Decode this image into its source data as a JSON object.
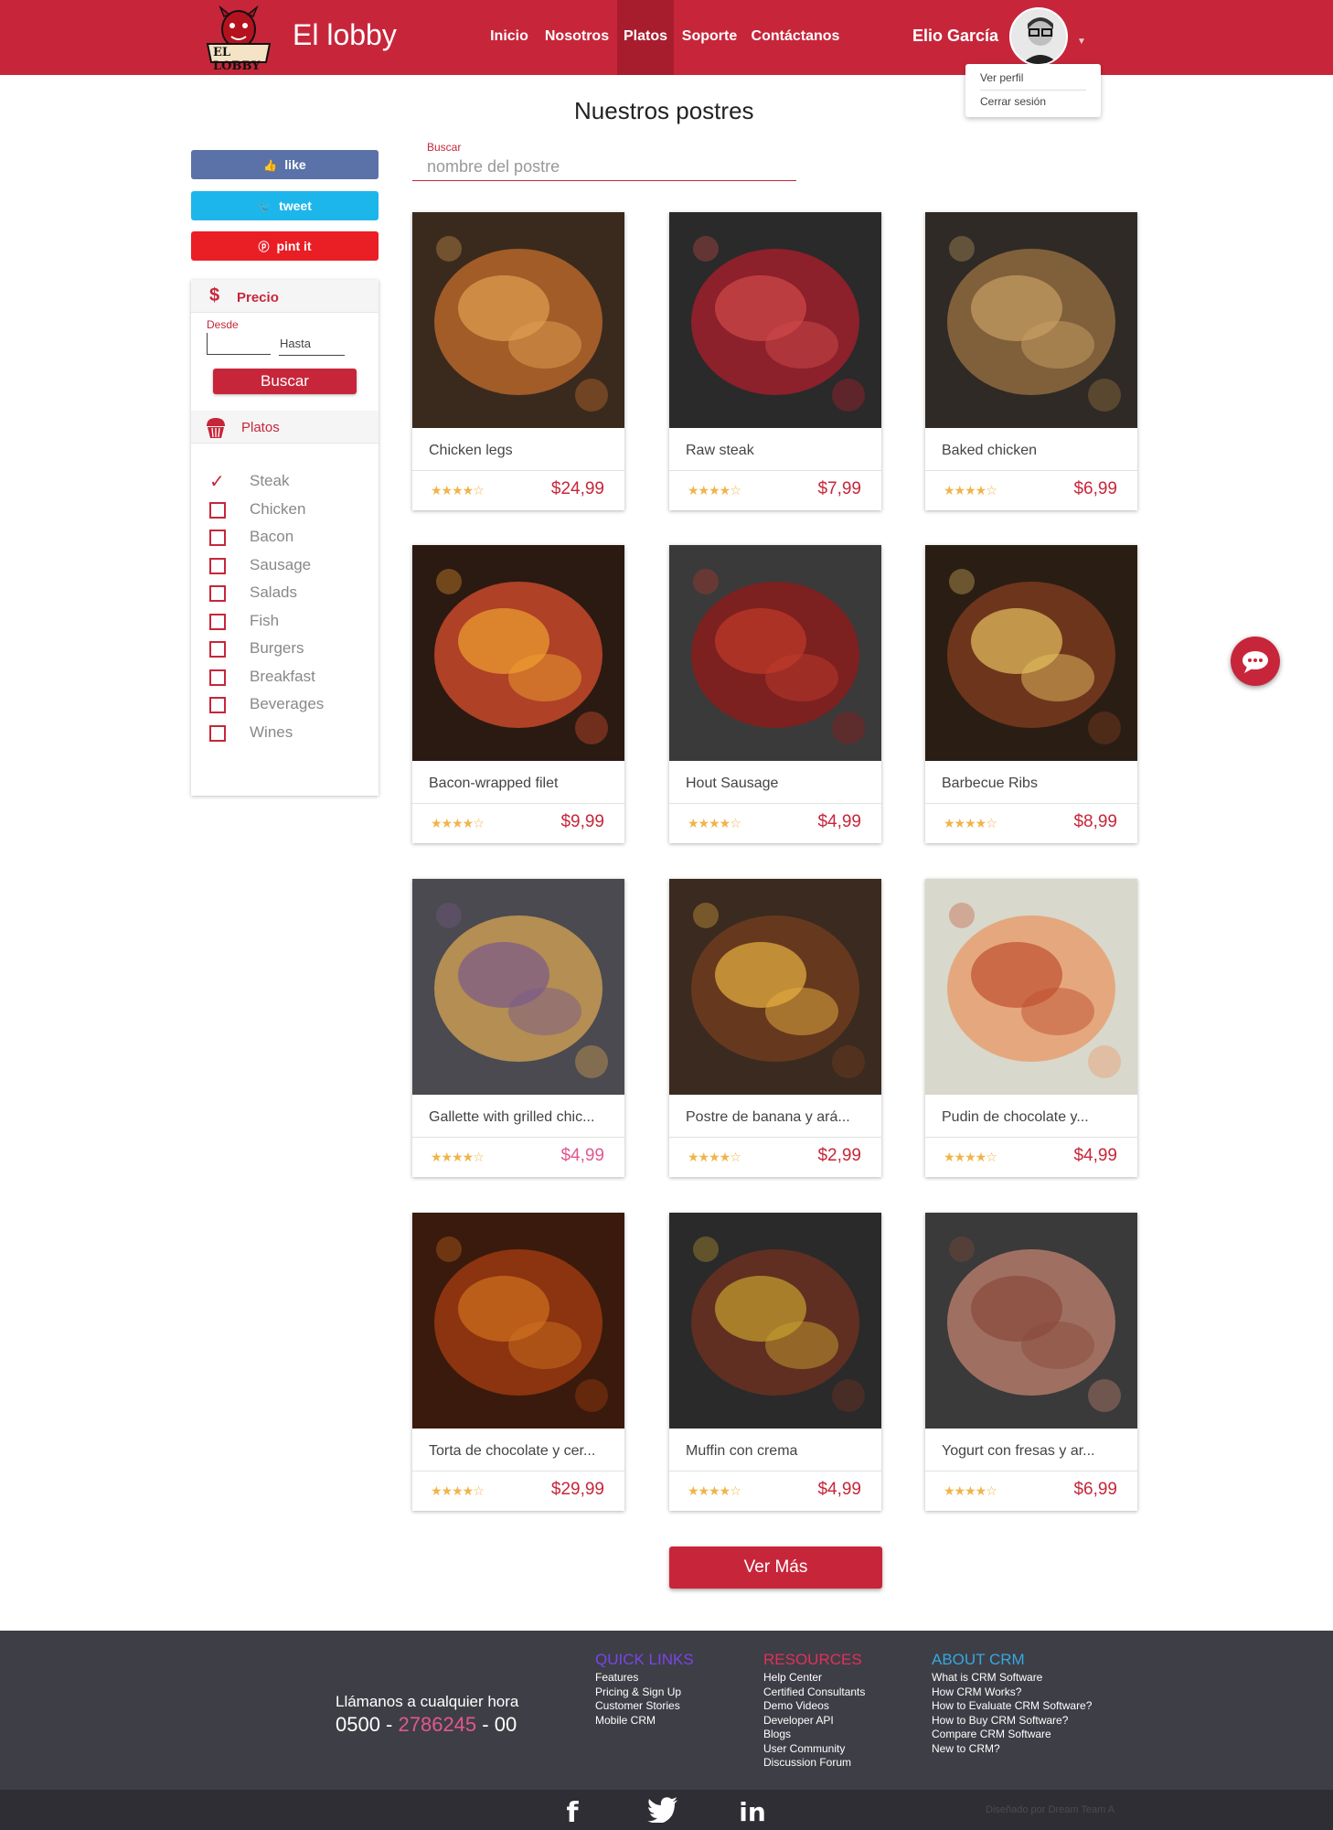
{
  "header": {
    "logo_text": "EL LOBBY",
    "brand": "El lobby",
    "nav": [
      "Inicio",
      "Nosotros",
      "Platos",
      "Soporte",
      "Contáctanos"
    ],
    "user_name": "Elio García"
  },
  "user_menu": {
    "view_profile": "Ver perfil",
    "logout": "Cerrar sesión"
  },
  "page_title": "Nuestros postres",
  "social": {
    "like": "like",
    "tweet": "tweet",
    "pin": "pint it"
  },
  "filter": {
    "price_title": "Precio",
    "price_symbol": "$",
    "from_label": "Desde",
    "to_label": "Hasta",
    "search_button": "Buscar",
    "categories_title": "Platos",
    "categories": [
      {
        "label": "Steak",
        "checked": true
      },
      {
        "label": "Chicken",
        "checked": false
      },
      {
        "label": "Bacon",
        "checked": false
      },
      {
        "label": "Sausage",
        "checked": false
      },
      {
        "label": "Salads",
        "checked": false
      },
      {
        "label": "Fish",
        "checked": false
      },
      {
        "label": "Burgers",
        "checked": false
      },
      {
        "label": "Breakfast",
        "checked": false
      },
      {
        "label": "Beverages",
        "checked": false
      },
      {
        "label": "Wines",
        "checked": false
      }
    ]
  },
  "search": {
    "label": "Buscar",
    "placeholder": "nombre del postre"
  },
  "products": [
    {
      "name": "Chicken legs",
      "price": "$24,99",
      "rating": 4.5
    },
    {
      "name": "Raw steak",
      "price": "$7,99",
      "rating": 4.5
    },
    {
      "name": "Baked chicken",
      "price": "$6,99",
      "rating": 4.5
    },
    {
      "name": "Bacon-wrapped filet",
      "price": "$9,99",
      "rating": 4.5
    },
    {
      "name": "Hout Sausage",
      "price": "$4,99",
      "rating": 4.5
    },
    {
      "name": "Barbecue Ribs",
      "price": "$8,99",
      "rating": 4.5
    },
    {
      "name": "Gallette with grilled chic...",
      "price": "$4,99",
      "rating": 4.5
    },
    {
      "name": "Postre de banana y ará...",
      "price": "$2,99",
      "rating": 4.5
    },
    {
      "name": "Pudin de chocolate y...",
      "price": "$4,99",
      "rating": 4.5
    },
    {
      "name": "Torta de chocolate y cer...",
      "price": "$29,99",
      "rating": 4.5
    },
    {
      "name": "Muffin con crema",
      "price": "$4,99",
      "rating": 4.5
    },
    {
      "name": "Yogurt con fresas y ar...",
      "price": "$6,99",
      "rating": 4.5
    }
  ],
  "load_more": "Ver Más",
  "footer": {
    "call_label": "Llámanos a cualquier hora",
    "phone_start": "0500 - ",
    "phone_mid": "2786245",
    "phone_end": " - 00",
    "quick_links": {
      "title": "QUICK LINKS",
      "links": [
        "Features",
        "Pricing & Sign Up",
        "Customer Stories",
        "Mobile CRM"
      ]
    },
    "resources": {
      "title": "RESOURCES",
      "links": [
        "Help Center",
        "Certified Consultants",
        "Demo Videos",
        "Developer API",
        "Blogs",
        "User Community",
        "Discussion Forum"
      ]
    },
    "about": {
      "title": "ABOUT CRM",
      "links": [
        "What is CRM Software",
        "How CRM Works?",
        "How to Evaluate CRM Software?",
        "How to Buy CRM Software?",
        "Compare CRM Software",
        "New to CRM?"
      ]
    },
    "social_icons": [
      "facebook-icon",
      "twitter-icon",
      "linkedin-icon"
    ],
    "credit": "Diseñado por Dream Team A"
  },
  "colors": {
    "brand_red": "#c7263a",
    "footer_bg": "#3e3e46",
    "star": "#f0b44a",
    "pink": "#e25791"
  }
}
